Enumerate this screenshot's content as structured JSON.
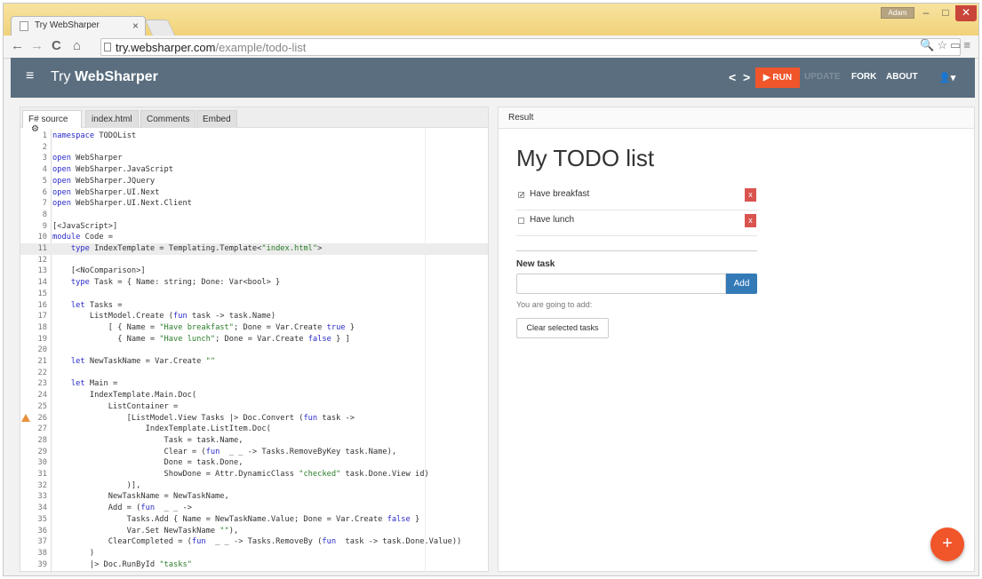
{
  "browser": {
    "tab_title": "Try WebSharper",
    "tab_close": "×",
    "user_badge": "Adam",
    "window_controls": {
      "minimize": "–",
      "maximize": "□",
      "close": "✕"
    },
    "url_domain": "try.websharper.com",
    "url_path": "/example/todo-list",
    "nav_back": "←",
    "nav_forward": "→",
    "nav_reload": "C",
    "nav_home": "⌂",
    "right_icons": "🔍☆▭≡"
  },
  "app": {
    "menu_icon": "≡",
    "brand_try": "Try ",
    "brand_name": "WebSharper",
    "prev": "<",
    "next": ">",
    "run": "▶ RUN",
    "update": "UPDATE",
    "fork": "FORK",
    "about": "ABOUT",
    "user_icon": "👤▾"
  },
  "editor": {
    "tabs": [
      "F# source",
      "index.html",
      "Comments",
      "Embed"
    ],
    "settings_icon": "⚙",
    "lines": [
      [
        "1",
        [
          [
            "kw",
            "namespace"
          ],
          [
            "",
            "TODOList"
          ]
        ]
      ],
      [
        "2",
        []
      ],
      [
        "3",
        [
          [
            "kw",
            "open"
          ],
          [
            "",
            "WebSharper"
          ]
        ]
      ],
      [
        "4",
        [
          [
            "kw",
            "open"
          ],
          [
            "",
            "WebSharper.JavaScript"
          ]
        ]
      ],
      [
        "5",
        [
          [
            "kw",
            "open"
          ],
          [
            "",
            "WebSharper.JQuery"
          ]
        ]
      ],
      [
        "6",
        [
          [
            "kw",
            "open"
          ],
          [
            "",
            "WebSharper.UI.Next"
          ]
        ]
      ],
      [
        "7",
        [
          [
            "kw",
            "open"
          ],
          [
            "",
            "WebSharper.UI.Next.Client"
          ]
        ]
      ],
      [
        "8",
        []
      ],
      [
        "9",
        [
          [
            "",
            "[<JavaScript>]"
          ]
        ]
      ],
      [
        "10",
        [
          [
            "kw",
            "module"
          ],
          [
            "",
            "Code ="
          ]
        ]
      ],
      [
        "11",
        [
          [
            "",
            "    "
          ],
          [
            "kw",
            "type"
          ],
          [
            "",
            "IndexTemplate = Templating.Template<"
          ],
          [
            "str",
            "\"index.html\""
          ],
          [
            "",
            ">"
          ]
        ]
      ],
      [
        "12",
        []
      ],
      [
        "13",
        [
          [
            "",
            "    [<NoComparison>]"
          ]
        ]
      ],
      [
        "14",
        [
          [
            "",
            "    "
          ],
          [
            "kw",
            "type"
          ],
          [
            "",
            "Task = { Name: string; Done: Var<bool> }"
          ]
        ]
      ],
      [
        "15",
        []
      ],
      [
        "16",
        [
          [
            "",
            "    "
          ],
          [
            "kw",
            "let"
          ],
          [
            "",
            "Tasks ="
          ]
        ]
      ],
      [
        "17",
        [
          [
            "",
            "        ListModel.Create ("
          ],
          [
            "kw",
            "fun"
          ],
          [
            "",
            "task -> task.Name)"
          ]
        ]
      ],
      [
        "18",
        [
          [
            "",
            "            [ { Name = "
          ],
          [
            "str",
            "\"Have breakfast\""
          ],
          [
            "",
            "; Done = Var.Create "
          ],
          [
            "kw",
            "true"
          ],
          [
            "",
            " }"
          ]
        ]
      ],
      [
        "19",
        [
          [
            "",
            "              { Name = "
          ],
          [
            "str",
            "\"Have lunch\""
          ],
          [
            "",
            "; Done = Var.Create "
          ],
          [
            "kw",
            "false"
          ],
          [
            "",
            " } ]"
          ]
        ]
      ],
      [
        "20",
        []
      ],
      [
        "21",
        [
          [
            "",
            "    "
          ],
          [
            "kw",
            "let"
          ],
          [
            "",
            "NewTaskName = Var.Create "
          ],
          [
            "str",
            "\"\""
          ]
        ]
      ],
      [
        "22",
        []
      ],
      [
        "23",
        [
          [
            "",
            "    "
          ],
          [
            "kw",
            "let"
          ],
          [
            "",
            "Main ="
          ]
        ]
      ],
      [
        "24",
        [
          [
            "",
            "        IndexTemplate.Main.Doc("
          ]
        ]
      ],
      [
        "25",
        [
          [
            "",
            "            ListContainer ="
          ]
        ]
      ],
      [
        "26",
        [
          [
            "",
            "                [ListModel.View Tasks |> Doc.Convert ("
          ],
          [
            "kw",
            "fun"
          ],
          [
            "",
            "task ->"
          ]
        ]
      ],
      [
        "27",
        [
          [
            "",
            "                    IndexTemplate.ListItem.Doc("
          ]
        ]
      ],
      [
        "28",
        [
          [
            "",
            "                        Task = task.Name,"
          ]
        ]
      ],
      [
        "29",
        [
          [
            "",
            "                        Clear = ("
          ],
          [
            "kw",
            "fun"
          ],
          [
            "",
            " _ _ -> Tasks.RemoveByKey task.Name),"
          ]
        ]
      ],
      [
        "30",
        [
          [
            "",
            "                        Done = task.Done,"
          ]
        ]
      ],
      [
        "31",
        [
          [
            "",
            "                        ShowDone = Attr.DynamicClass "
          ],
          [
            "str",
            "\"checked\""
          ],
          [
            "",
            " task.Done.View id)"
          ]
        ]
      ],
      [
        "32",
        [
          [
            "",
            "                )],"
          ]
        ]
      ],
      [
        "33",
        [
          [
            "",
            "            NewTaskName = NewTaskName,"
          ]
        ]
      ],
      [
        "34",
        [
          [
            "",
            "            Add = ("
          ],
          [
            "kw",
            "fun"
          ],
          [
            "",
            " _ _ ->"
          ]
        ]
      ],
      [
        "35",
        [
          [
            "",
            "                Tasks.Add { Name = NewTaskName.Value; Done = Var.Create "
          ],
          [
            "kw",
            "false"
          ],
          [
            "",
            " }"
          ]
        ]
      ],
      [
        "36",
        [
          [
            "",
            "                Var.Set NewTaskName "
          ],
          [
            "str",
            "\"\""
          ],
          [
            "",
            "),"
          ]
        ]
      ],
      [
        "37",
        [
          [
            "",
            "            ClearCompleted = ("
          ],
          [
            "kw",
            "fun"
          ],
          [
            "",
            " _ _ -> Tasks.RemoveBy ("
          ],
          [
            "kw",
            "fun"
          ],
          [
            "",
            " task -> task.Done.Value))"
          ]
        ]
      ],
      [
        "38",
        [
          [
            "",
            "        )"
          ]
        ]
      ],
      [
        "39",
        [
          [
            "",
            "        |> Doc.RunById "
          ],
          [
            "str",
            "\"tasks\""
          ]
        ]
      ]
    ]
  },
  "result": {
    "header": "Result",
    "title": "My TODO list",
    "items": [
      {
        "label": "Have breakfast",
        "checked": true,
        "check": "✓",
        "remove": "x"
      },
      {
        "label": "Have lunch",
        "checked": false,
        "check": "",
        "remove": "x"
      }
    ],
    "new_task_label": "New task",
    "new_task_value": "",
    "add": "Add",
    "going": "You are going to add:",
    "clear": "Clear selected tasks",
    "fab": "+"
  }
}
